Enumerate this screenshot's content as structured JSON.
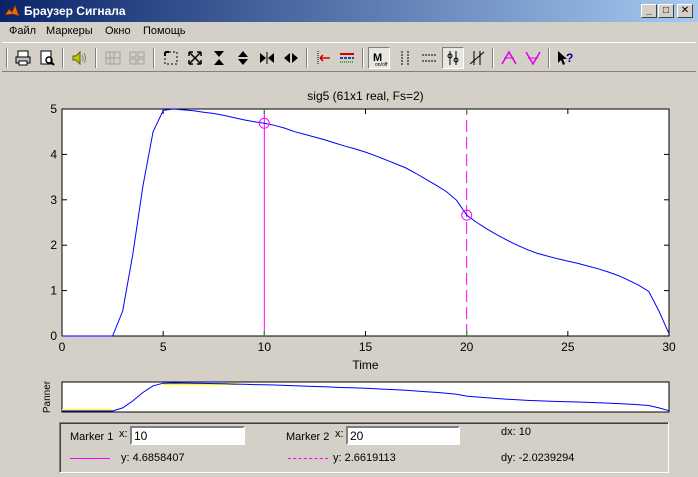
{
  "window": {
    "title": "Браузер Сигнала",
    "controls": {
      "minimize": "_",
      "maximize": "□",
      "close": "✕"
    }
  },
  "menu": [
    "Файл",
    "Маркеры",
    "Окно",
    "Помощь"
  ],
  "toolbar": {
    "icons": [
      "print-icon",
      "print-preview-icon",
      "speaker-icon",
      "array-signals-icon",
      "array-signals-alt-icon",
      "zoom-box-icon",
      "zoom-full-icon",
      "zoom-in-x-icon",
      "zoom-in-y-icon",
      "zoom-out-x-icon",
      "zoom-out-y-icon",
      "marker-left-icon",
      "line-style-icon",
      "marker-mode-icon",
      "vertical-markers-icon",
      "horizontal-markers-icon",
      "track-markers-icon",
      "slope-markers-icon",
      "peaks-icon",
      "valleys-icon",
      "context-help-icon"
    ]
  },
  "chart_data": {
    "type": "line",
    "title": "sig5 (61x1 real, Fs=2)",
    "xlabel": "Time",
    "ylabel": "",
    "xlim": [
      0,
      30
    ],
    "ylim": [
      0,
      5
    ],
    "xticks": [
      "0",
      "5",
      "10",
      "15",
      "20",
      "25",
      "30"
    ],
    "yticks": [
      "0",
      "1",
      "2",
      "3",
      "4",
      "5"
    ],
    "grid": false,
    "line_color": "#0000ff",
    "series": [
      {
        "x": [
          0,
          0.5,
          1,
          1.5,
          2,
          2.5,
          3,
          3.5,
          4,
          4.5,
          5,
          5.5,
          6,
          6.5,
          7,
          7.5,
          8,
          8.5,
          9,
          9.5,
          10,
          10.5,
          11,
          11.5,
          12,
          12.5,
          13,
          13.5,
          14,
          14.5,
          15,
          15.5,
          16,
          16.5,
          17,
          17.5,
          18,
          18.5,
          19,
          19.5,
          20,
          20.5,
          21,
          21.5,
          22,
          22.5,
          23,
          23.5,
          24,
          24.5,
          25,
          25.5,
          26,
          26.5,
          27,
          27.5,
          28,
          28.5,
          29,
          29.5,
          30
        ],
        "values": [
          0,
          0,
          0,
          0,
          0,
          0,
          0.55,
          1.8,
          3.3,
          4.5,
          4.97,
          5.0,
          4.98,
          4.96,
          4.93,
          4.9,
          4.86,
          4.81,
          4.76,
          4.72,
          4.686,
          4.64,
          4.58,
          4.5,
          4.44,
          4.38,
          4.32,
          4.25,
          4.18,
          4.12,
          4.05,
          3.97,
          3.88,
          3.79,
          3.7,
          3.58,
          3.45,
          3.32,
          3.18,
          2.99,
          2.662,
          2.5,
          2.36,
          2.23,
          2.11,
          2.0,
          1.9,
          1.82,
          1.76,
          1.7,
          1.65,
          1.6,
          1.54,
          1.48,
          1.41,
          1.33,
          1.23,
          1.12,
          0.98,
          0.55,
          0.05
        ]
      }
    ],
    "markers": [
      {
        "x": 10,
        "y": 4.6858407,
        "color": "#ff00ff",
        "style": "solid"
      },
      {
        "x": 20,
        "y": 2.6619113,
        "color": "#ff00ff",
        "style": "dashed"
      }
    ],
    "panner": {
      "ylabel": "Panner",
      "highlight_color": "#ffff00",
      "highlight_ranges": [
        [
          0,
          2.5
        ],
        [
          5,
          8.7
        ]
      ]
    }
  },
  "markers_panel": {
    "marker1_label": "Marker 1",
    "marker2_label": "Marker 2",
    "x_label": "x:",
    "marker1_x": "10",
    "marker2_x": "20",
    "marker1_y": "y: 4.6858407",
    "marker2_y": "y: 2.6619113",
    "dx": "dx: 10",
    "dy": "dy: -2.0239294",
    "marker1_line_color": "#ff00ff",
    "marker2_line_color": "#ff00ff"
  }
}
